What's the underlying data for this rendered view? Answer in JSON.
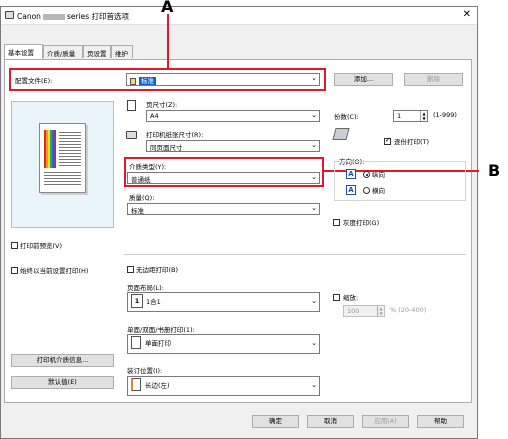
{
  "window": {
    "title_prefix": "Canon",
    "title_suffix": "series 打印首选项",
    "close": "✕"
  },
  "tabs": [
    "基本设置",
    "介质/质量",
    "页设置",
    "维护"
  ],
  "profile": {
    "label": "配置文件(E):",
    "value": "标准",
    "add_button": "添加...",
    "delete_button": "删除"
  },
  "page_size": {
    "label": "页尺寸(Z):",
    "value": "A4"
  },
  "printer_paper_size": {
    "label": "打印机纸张尺寸(R):",
    "value": "同页面尺寸"
  },
  "media_type": {
    "label": "介质类型(Y):",
    "value": "普通纸"
  },
  "quality": {
    "label": "质量(Q):",
    "value": "标准"
  },
  "copies": {
    "label": "份数(C):",
    "value": "1",
    "range": "(1-999)",
    "collate_label": "逐份打印(T)",
    "collate_checked": true
  },
  "orientation": {
    "label": "方向(O):",
    "portrait": "纵向",
    "landscape": "横向",
    "selected": "portrait",
    "portrait_icon_letter": "A",
    "landscape_icon_letter": "A"
  },
  "grayscale": {
    "label": "灰度打印(G)"
  },
  "preview_before_print": {
    "label": "打印前预览(V)"
  },
  "always_print_current": {
    "label": "始终以当前设置打印(H)"
  },
  "borderless": {
    "label": "无边距打印(B)"
  },
  "page_layout": {
    "label": "页面布局(L):",
    "value": "1合1",
    "icon_number": "1"
  },
  "scaling": {
    "label": "缩放:",
    "value": "100",
    "range": "% (20-400)"
  },
  "duplex": {
    "label": "单面/双面/书册打印(1):",
    "value": "单面打印"
  },
  "binding": {
    "label": "装订位置(I):",
    "value": "长边(左)"
  },
  "left_buttons": {
    "media_info": "打印机介质信息...",
    "defaults": "默认值(E)"
  },
  "footer": {
    "ok": "确定",
    "cancel": "取消",
    "apply": "应用(A)",
    "help": "帮助"
  },
  "callouts": {
    "a": "A",
    "b": "B"
  },
  "colors": {
    "callout_red": "#e11a2b",
    "accent_blue": "#1f4ea3"
  }
}
